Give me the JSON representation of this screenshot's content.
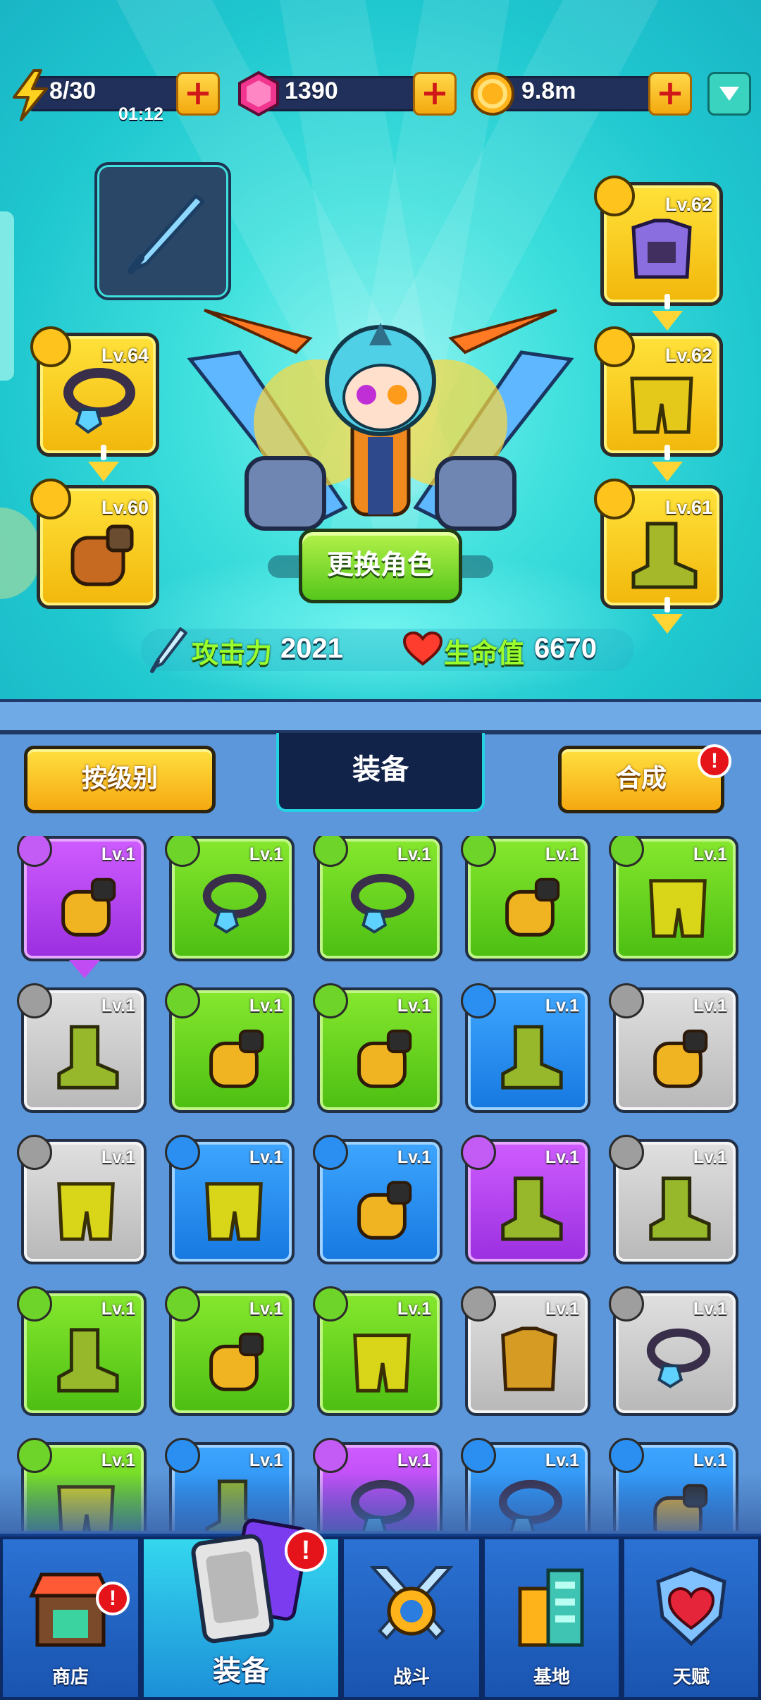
{
  "resources": {
    "energy": {
      "value": "8/30",
      "timer": "01:12",
      "icon": "lightning-icon"
    },
    "gems": {
      "value": "1390",
      "icon": "gem-icon"
    },
    "coins": {
      "value": "9.8m",
      "icon": "coin-icon"
    },
    "plus_label": "+"
  },
  "hero": {
    "weapon_icon": "sword-icon",
    "slots": {
      "necklace": {
        "level": "Lv.64",
        "icon": "necklace-icon"
      },
      "glove": {
        "level": "Lv.60",
        "icon": "glove-icon"
      },
      "armor": {
        "level": "Lv.62",
        "icon": "armor-icon"
      },
      "pants": {
        "level": "Lv.62",
        "icon": "pants-icon"
      },
      "boots": {
        "level": "Lv.61",
        "icon": "boot-icon"
      }
    },
    "change_character_label": "更换角色",
    "attack_label": "攻击力",
    "attack_value": "2021",
    "hp_label": "生命值",
    "hp_value": "6670"
  },
  "inventory": {
    "sort_label": "按级别",
    "tab_title": "装备",
    "merge_label": "合成",
    "merge_alert": "!",
    "items": [
      {
        "level": "Lv.1",
        "rarity": "purple",
        "type": "glove"
      },
      {
        "level": "Lv.1",
        "rarity": "green",
        "type": "necklace"
      },
      {
        "level": "Lv.1",
        "rarity": "green",
        "type": "necklace"
      },
      {
        "level": "Lv.1",
        "rarity": "green",
        "type": "glove"
      },
      {
        "level": "Lv.1",
        "rarity": "green",
        "type": "pants"
      },
      {
        "level": "Lv.1",
        "rarity": "gray",
        "type": "boots"
      },
      {
        "level": "Lv.1",
        "rarity": "green",
        "type": "glove"
      },
      {
        "level": "Lv.1",
        "rarity": "green",
        "type": "glove"
      },
      {
        "level": "Lv.1",
        "rarity": "blue",
        "type": "boots"
      },
      {
        "level": "Lv.1",
        "rarity": "gray",
        "type": "glove"
      },
      {
        "level": "Lv.1",
        "rarity": "gray",
        "type": "pants"
      },
      {
        "level": "Lv.1",
        "rarity": "blue",
        "type": "pants"
      },
      {
        "level": "Lv.1",
        "rarity": "blue",
        "type": "glove"
      },
      {
        "level": "Lv.1",
        "rarity": "purple",
        "type": "boots"
      },
      {
        "level": "Lv.1",
        "rarity": "gray",
        "type": "boots"
      },
      {
        "level": "Lv.1",
        "rarity": "green",
        "type": "boots"
      },
      {
        "level": "Lv.1",
        "rarity": "green",
        "type": "glove"
      },
      {
        "level": "Lv.1",
        "rarity": "green",
        "type": "pants"
      },
      {
        "level": "Lv.1",
        "rarity": "gray",
        "type": "armor"
      },
      {
        "level": "Lv.1",
        "rarity": "gray",
        "type": "necklace"
      },
      {
        "level": "Lv.1",
        "rarity": "green",
        "type": "pants"
      },
      {
        "level": "Lv.1",
        "rarity": "blue",
        "type": "boots"
      },
      {
        "level": "Lv.1",
        "rarity": "purple",
        "type": "necklace"
      },
      {
        "level": "Lv.1",
        "rarity": "blue",
        "type": "necklace"
      },
      {
        "level": "Lv.1",
        "rarity": "blue",
        "type": "glove"
      }
    ]
  },
  "nav": {
    "shop": {
      "label": "商店",
      "icon": "shop-icon",
      "alert": "!"
    },
    "equipment": {
      "label": "装备",
      "icon": "cards-icon",
      "alert": "!"
    },
    "battle": {
      "label": "战斗",
      "icon": "crossed-swords-icon"
    },
    "base": {
      "label": "基地",
      "icon": "building-icon"
    },
    "talent": {
      "label": "天赋",
      "icon": "heart-shield-icon"
    }
  },
  "colors": {
    "rarity_purple": "#b344f0",
    "rarity_green": "#6cd424",
    "rarity_gray": "#cfcfcf",
    "rarity_blue": "#2a8ff0",
    "stat_label": "#9bff2e"
  }
}
